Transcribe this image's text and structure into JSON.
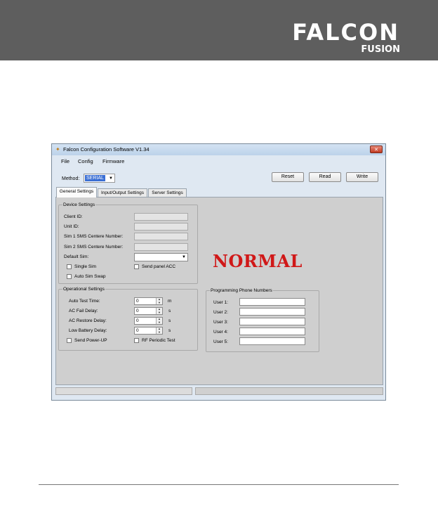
{
  "brand": {
    "name": "FALCON",
    "sub": "FUSION"
  },
  "window": {
    "title": "Falcon Configuration Software V1.34",
    "close": "✕",
    "menu": [
      "File",
      "Config",
      "Firmware"
    ],
    "method": {
      "label": "Method:",
      "value": "SERIAL"
    },
    "buttons": {
      "reset": "Reset",
      "read": "Read",
      "write": "Write"
    },
    "tabs": [
      "General Settings",
      "Input/Output Settings",
      "Server Settings"
    ]
  },
  "device": {
    "title": "Device Settings",
    "client_id": "Client ID:",
    "unit_id": "Unit ID:",
    "sim1": "Sim 1 SMS Centere Number:",
    "sim2": "Sim 2 SMS Centere Number:",
    "default_sim": "Default Sim:",
    "single_sim": "Single Sim",
    "send_panel_acc": "Send panel ACC",
    "auto_sim_swap": "Auto Sim Swap"
  },
  "operational": {
    "title": "Operational Settings",
    "auto_test": "Auto Test Time:",
    "ac_fail": "AC Fail Delay:",
    "ac_restore": "AC Restore Delay:",
    "low_battery": "Low Battery Delay:",
    "values": [
      "0",
      "0",
      "0",
      "0"
    ],
    "units": [
      "m",
      "s",
      "s",
      "s"
    ],
    "send_power_up": "Send Power-UP",
    "rf_periodic": "RF Periodic Test"
  },
  "phones": {
    "title": "Programming Phone Numbers",
    "users": [
      "User 1:",
      "User 2:",
      "User 3:",
      "User 4:",
      "User 5:"
    ]
  },
  "status_text": "NORMAL",
  "colors": {
    "status": "#d01818",
    "header": "#5e5e5e",
    "selection": "#3b6fd4"
  }
}
